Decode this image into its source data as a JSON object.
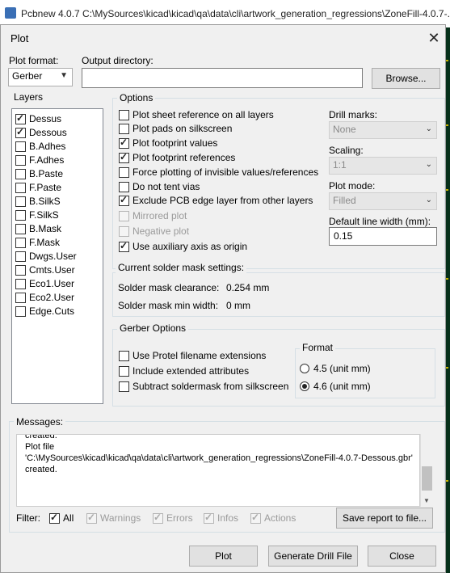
{
  "main_window": {
    "title": "Pcbnew 4.0.7 C:\\MySources\\kicad\\kicad\\qa\\data\\cli\\artwork_generation_regressions\\ZoneFill-4.0.7-..."
  },
  "dialog": {
    "title": "Plot",
    "plot_format_label": "Plot format:",
    "plot_format_value": "Gerber",
    "output_dir_label": "Output directory:",
    "output_dir_value": "",
    "browse_label": "Browse..."
  },
  "layers": {
    "title": "Layers",
    "items": [
      {
        "label": "Dessus",
        "checked": true
      },
      {
        "label": "Dessous",
        "checked": true
      },
      {
        "label": "B.Adhes",
        "checked": false
      },
      {
        "label": "F.Adhes",
        "checked": false
      },
      {
        "label": "B.Paste",
        "checked": false
      },
      {
        "label": "F.Paste",
        "checked": false
      },
      {
        "label": "B.SilkS",
        "checked": false
      },
      {
        "label": "F.SilkS",
        "checked": false
      },
      {
        "label": "B.Mask",
        "checked": false
      },
      {
        "label": "F.Mask",
        "checked": false
      },
      {
        "label": "Dwgs.User",
        "checked": false
      },
      {
        "label": "Cmts.User",
        "checked": false
      },
      {
        "label": "Eco1.User",
        "checked": false
      },
      {
        "label": "Eco2.User",
        "checked": false
      },
      {
        "label": "Edge.Cuts",
        "checked": false
      }
    ]
  },
  "options": {
    "title": "Options",
    "checkboxes": [
      {
        "label": "Plot sheet reference on all layers",
        "checked": false,
        "enabled": true
      },
      {
        "label": "Plot pads on silkscreen",
        "checked": false,
        "enabled": true
      },
      {
        "label": "Plot footprint values",
        "checked": true,
        "enabled": true
      },
      {
        "label": "Plot footprint references",
        "checked": true,
        "enabled": true
      },
      {
        "label": "Force plotting of invisible values/references",
        "checked": false,
        "enabled": true
      },
      {
        "label": "Do not tent vias",
        "checked": false,
        "enabled": true
      },
      {
        "label": "Exclude PCB edge layer from other layers",
        "checked": true,
        "enabled": true
      },
      {
        "label": "Mirrored plot",
        "checked": false,
        "enabled": false
      },
      {
        "label": "Negative plot",
        "checked": false,
        "enabled": false
      },
      {
        "label": "Use auxiliary axis as origin",
        "checked": true,
        "enabled": true
      }
    ],
    "drill_marks_label": "Drill marks:",
    "drill_marks_value": "None",
    "scaling_label": "Scaling:",
    "scaling_value": "1:1",
    "plot_mode_label": "Plot mode:",
    "plot_mode_value": "Filled",
    "line_width_label": "Default line width (mm):",
    "line_width_value": "0.15"
  },
  "solder_mask": {
    "title": "Current solder mask settings:",
    "clearance_label": "Solder mask clearance:",
    "clearance_value": "0.254 mm",
    "min_width_label": "Solder mask min width:",
    "min_width_value": "0 mm"
  },
  "gerber": {
    "title": "Gerber Options",
    "checkboxes": [
      {
        "label": "Use Protel filename extensions",
        "checked": false
      },
      {
        "label": "Include extended attributes",
        "checked": false
      },
      {
        "label": "Subtract soldermask from silkscreen",
        "checked": false
      }
    ],
    "format_title": "Format",
    "format_options": [
      {
        "label": "4.5 (unit mm)",
        "selected": false
      },
      {
        "label": "4.6 (unit mm)",
        "selected": true
      }
    ]
  },
  "messages": {
    "title": "Messages:",
    "lines": [
      "created.",
      "Plot file",
      "'C:\\MySources\\kicad\\kicad\\qa\\data\\cli\\artwork_generation_regressions\\ZoneFill-4.0.7-Dessous.gbr'",
      "created."
    ]
  },
  "filter": {
    "label": "Filter:",
    "items": [
      {
        "label": "All",
        "checked": true,
        "enabled": true
      },
      {
        "label": "Warnings",
        "checked": true,
        "enabled": false
      },
      {
        "label": "Errors",
        "checked": true,
        "enabled": false
      },
      {
        "label": "Infos",
        "checked": true,
        "enabled": false
      },
      {
        "label": "Actions",
        "checked": true,
        "enabled": false
      }
    ],
    "save_report_label": "Save report to file..."
  },
  "buttons": {
    "plot": "Plot",
    "drill": "Generate Drill File",
    "close": "Close"
  }
}
